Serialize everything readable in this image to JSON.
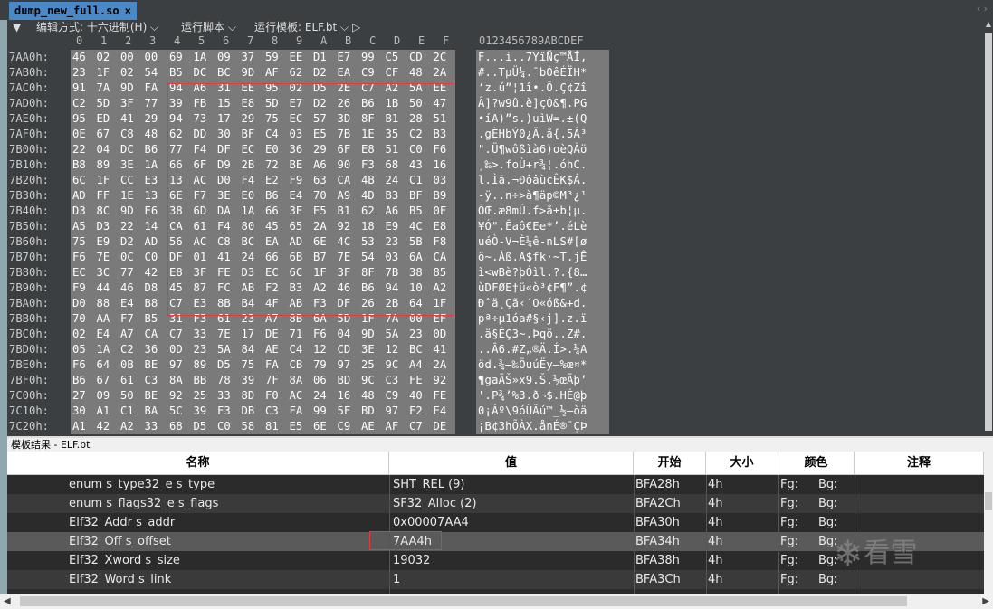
{
  "tab": {
    "title": "dump_new_full.so",
    "close": "×"
  },
  "tab_nav": "‹ ›",
  "toolbar": {
    "arrow": "▼",
    "edit_mode": "编辑方式: 十六进制(H) ⌵",
    "run_script": "运行脚本 ⌵",
    "run_template": "运行模板: ELF.bt ⌵ ▷"
  },
  "hex_header": [
    "0",
    "1",
    "2",
    "3",
    "4",
    "5",
    "6",
    "7",
    "8",
    "9",
    "A",
    "B",
    "C",
    "D",
    "E",
    "F"
  ],
  "ascii_header": "0123456789ABCDEF",
  "rows": [
    {
      "addr": "7AA0h:",
      "hex": [
        "46",
        "02",
        "00",
        "00",
        "69",
        "1A",
        "09",
        "37",
        "59",
        "EE",
        "D1",
        "E7",
        "99",
        "C5",
        "CD",
        "2C"
      ],
      "ascii": "F...i..7YîÑç™ÅÍ,"
    },
    {
      "addr": "7AB0h:",
      "hex": [
        "23",
        "1F",
        "02",
        "54",
        "B5",
        "DC",
        "BC",
        "9D",
        "AF",
        "62",
        "D2",
        "EA",
        "C9",
        "CF",
        "48",
        "2A"
      ],
      "ascii": "#..TµÜ¼.¯bÒêÉÏH*"
    },
    {
      "addr": "7AC0h:",
      "hex": [
        "91",
        "7A",
        "9D",
        "FA",
        "94",
        "A6",
        "31",
        "EE",
        "95",
        "02",
        "D5",
        "2E",
        "C7",
        "A2",
        "5A",
        "EE"
      ],
      "ascii": "‘z.ú”¦1î•.Õ.Ç¢Zî"
    },
    {
      "addr": "7AD0h:",
      "hex": [
        "C2",
        "5D",
        "3F",
        "77",
        "39",
        "FB",
        "15",
        "E8",
        "5D",
        "E7",
        "D2",
        "26",
        "B6",
        "1B",
        "50",
        "47"
      ],
      "ascii": "Â]?w9û.è]çÒ&¶.PG"
    },
    {
      "addr": "7AE0h:",
      "hex": [
        "95",
        "ED",
        "41",
        "29",
        "94",
        "73",
        "17",
        "29",
        "75",
        "EC",
        "57",
        "3D",
        "8F",
        "B1",
        "28",
        "51"
      ],
      "ascii": "•íA)”s.)uìW=.±(Q"
    },
    {
      "addr": "7AF0h:",
      "hex": [
        "0E",
        "67",
        "C8",
        "48",
        "62",
        "DD",
        "30",
        "BF",
        "C4",
        "03",
        "E5",
        "7B",
        "1E",
        "35",
        "C2",
        "B3"
      ],
      "ascii": ".gÈHbÝ0¿Ä.å{.5Â³"
    },
    {
      "addr": "7B00h:",
      "hex": [
        "22",
        "04",
        "DC",
        "B6",
        "77",
        "F4",
        "DF",
        "EC",
        "E0",
        "36",
        "29",
        "6F",
        "E8",
        "51",
        "C0",
        "F6"
      ],
      "ascii": "\".Ü¶wôßìà6)oèQÀö"
    },
    {
      "addr": "7B10h:",
      "hex": [
        "B8",
        "89",
        "3E",
        "1A",
        "66",
        "6F",
        "D9",
        "2B",
        "72",
        "BE",
        "A6",
        "90",
        "F3",
        "68",
        "43",
        "16"
      ],
      "ascii": "¸‰>.foÙ+r¾¦.óhC."
    },
    {
      "addr": "7B20h:",
      "hex": [
        "6C",
        "1F",
        "CC",
        "E3",
        "13",
        "AC",
        "D0",
        "F4",
        "E2",
        "F9",
        "63",
        "CA",
        "4B",
        "24",
        "C1",
        "03"
      ],
      "ascii": "l.Ìã.¬ÐôâùcÊK$Á."
    },
    {
      "addr": "7B30h:",
      "hex": [
        "AD",
        "FF",
        "1E",
        "13",
        "6E",
        "F7",
        "3E",
        "E0",
        "B6",
        "E4",
        "70",
        "A9",
        "4D",
        "B3",
        "BF",
        "B9"
      ],
      "ascii": "-ÿ..n÷>à¶äp©M³¿¹"
    },
    {
      "addr": "7B40h:",
      "hex": [
        "D3",
        "8C",
        "9D",
        "E6",
        "38",
        "6D",
        "DA",
        "1A",
        "66",
        "3E",
        "E5",
        "B1",
        "62",
        "A6",
        "B5",
        "0F"
      ],
      "ascii": "ÓŒ.æ8mÚ.f>å±b¦µ."
    },
    {
      "addr": "7B50h:",
      "hex": [
        "A5",
        "D3",
        "22",
        "14",
        "CA",
        "61",
        "F4",
        "80",
        "45",
        "65",
        "2A",
        "92",
        "18",
        "E9",
        "4C",
        "E8"
      ],
      "ascii": "¥Ó\".Êaô€Ee*’.éLè"
    },
    {
      "addr": "7B60h:",
      "hex": [
        "75",
        "E9",
        "D2",
        "AD",
        "56",
        "AC",
        "C8",
        "BC",
        "EA",
        "AD",
        "6E",
        "4C",
        "53",
        "23",
        "5B",
        "F8"
      ],
      "ascii": "uéÒ-V¬È¼ê-nLS#[ø"
    },
    {
      "addr": "7B70h:",
      "hex": [
        "F6",
        "7E",
        "0C",
        "C0",
        "DF",
        "01",
        "41",
        "24",
        "66",
        "6B",
        "B7",
        "7E",
        "54",
        "03",
        "6A",
        "CA"
      ],
      "ascii": "ö~.Àß.A$fk·~T.jÊ"
    },
    {
      "addr": "7B80h:",
      "hex": [
        "EC",
        "3C",
        "77",
        "42",
        "E8",
        "3F",
        "FE",
        "D3",
        "EC",
        "6C",
        "1F",
        "3F",
        "8F",
        "7B",
        "38",
        "85"
      ],
      "ascii": "ì<wBè?þÓìl.?.{8…"
    },
    {
      "addr": "7B90h:",
      "hex": [
        "F9",
        "44",
        "46",
        "D8",
        "45",
        "87",
        "FC",
        "AB",
        "F2",
        "B3",
        "A2",
        "46",
        "B6",
        "94",
        "10",
        "A2"
      ],
      "ascii": "ùDFØE‡ü«ò³¢F¶”.¢"
    },
    {
      "addr": "7BA0h:",
      "hex": [
        "D0",
        "88",
        "E4",
        "B8",
        "C7",
        "E3",
        "8B",
        "B4",
        "4F",
        "AB",
        "F3",
        "DF",
        "26",
        "2B",
        "64",
        "1F"
      ],
      "ascii": "Ðˆä¸Çã‹´O«óß&+d."
    },
    {
      "addr": "7BB0h:",
      "hex": [
        "70",
        "AA",
        "F7",
        "B5",
        "31",
        "F3",
        "61",
        "23",
        "A7",
        "8B",
        "6A",
        "5D",
        "1F",
        "7A",
        "00",
        "EF"
      ],
      "ascii": "pª÷µ1óa#§‹j].z.ï"
    },
    {
      "addr": "7BC0h:",
      "hex": [
        "02",
        "E4",
        "A7",
        "CA",
        "C7",
        "33",
        "7E",
        "17",
        "DE",
        "71",
        "F6",
        "04",
        "9D",
        "5A",
        "23",
        "0D"
      ],
      "ascii": ".ä§ÊÇ3~.Þqö..Z#."
    },
    {
      "addr": "7BD0h:",
      "hex": [
        "05",
        "1A",
        "C2",
        "36",
        "0D",
        "23",
        "5A",
        "84",
        "AE",
        "C4",
        "12",
        "CD",
        "3E",
        "12",
        "BC",
        "41"
      ],
      "ascii": "..Â6.#Z„®Ä.Í>.¼A"
    },
    {
      "addr": "7BE0h:",
      "hex": [
        "F6",
        "64",
        "0B",
        "BE",
        "97",
        "89",
        "D5",
        "75",
        "FA",
        "CB",
        "79",
        "97",
        "25",
        "9C",
        "A4",
        "2A"
      ],
      "ascii": "öd.¾—‰ÕuúËy—%œ¤*"
    },
    {
      "addr": "7BF0h:",
      "hex": [
        "B6",
        "67",
        "61",
        "C3",
        "8A",
        "BB",
        "78",
        "39",
        "7F",
        "8A",
        "06",
        "BD",
        "9C",
        "C3",
        "FE",
        "92"
      ],
      "ascii": "¶gaÃŠ»x9.Š.½œÃþ’"
    },
    {
      "addr": "7C00h:",
      "hex": [
        "27",
        "09",
        "50",
        "BE",
        "92",
        "25",
        "33",
        "8D",
        "F0",
        "AC",
        "24",
        "16",
        "48",
        "C9",
        "40",
        "FE"
      ],
      "ascii": "'.P¾’%3.ð¬$.HÉ@þ"
    },
    {
      "addr": "7C10h:",
      "hex": [
        "30",
        "A1",
        "C1",
        "BA",
        "5C",
        "39",
        "F3",
        "DB",
        "C3",
        "FA",
        "99",
        "5F",
        "BD",
        "97",
        "F2",
        "E4"
      ],
      "ascii": "0¡Áº\\9óÛÃú™_½—òä"
    },
    {
      "addr": "7C20h:",
      "hex": [
        "A1",
        "42",
        "A2",
        "33",
        "68",
        "D5",
        "C0",
        "58",
        "81",
        "E5",
        "6E",
        "C9",
        "AE",
        "AF",
        "C7",
        "DE"
      ],
      "ascii": "¡B¢3hÕÀX.ånÉ®¯ÇÞ"
    }
  ],
  "template_title": "模板结果 - ELF.bt",
  "columns": {
    "name": "名称",
    "value": "值",
    "start": "开始",
    "size": "大小",
    "color": "颜色",
    "comment": "注释"
  },
  "template_rows": [
    {
      "name": "enum s_type32_e s_type",
      "value": "SHT_REL (9)",
      "start": "BFA28h",
      "size": "4h",
      "fg": "Fg:",
      "bg": "Bg:"
    },
    {
      "name": "enum s_flags32_e s_flags",
      "value": "SF32_Alloc (2)",
      "start": "BFA2Ch",
      "size": "4h",
      "fg": "Fg:",
      "bg": "Bg:"
    },
    {
      "name": "Elf32_Addr s_addr",
      "value": "0x00007AA4",
      "start": "BFA30h",
      "size": "4h",
      "fg": "Fg:",
      "bg": "Bg:"
    },
    {
      "name": "Elf32_Off s_offset",
      "value": "7AA4h",
      "start": "BFA34h",
      "size": "4h",
      "fg": "Fg:",
      "bg": "Bg:"
    },
    {
      "name": "Elf32_Xword s_size",
      "value": "19032",
      "start": "BFA38h",
      "size": "4h",
      "fg": "Fg:",
      "bg": "Bg:"
    },
    {
      "name": "Elf32_Word s_link",
      "value": "1",
      "start": "BFA3Ch",
      "size": "4h",
      "fg": "Fg:",
      "bg": "Bg:"
    }
  ],
  "watermark": "看雪"
}
